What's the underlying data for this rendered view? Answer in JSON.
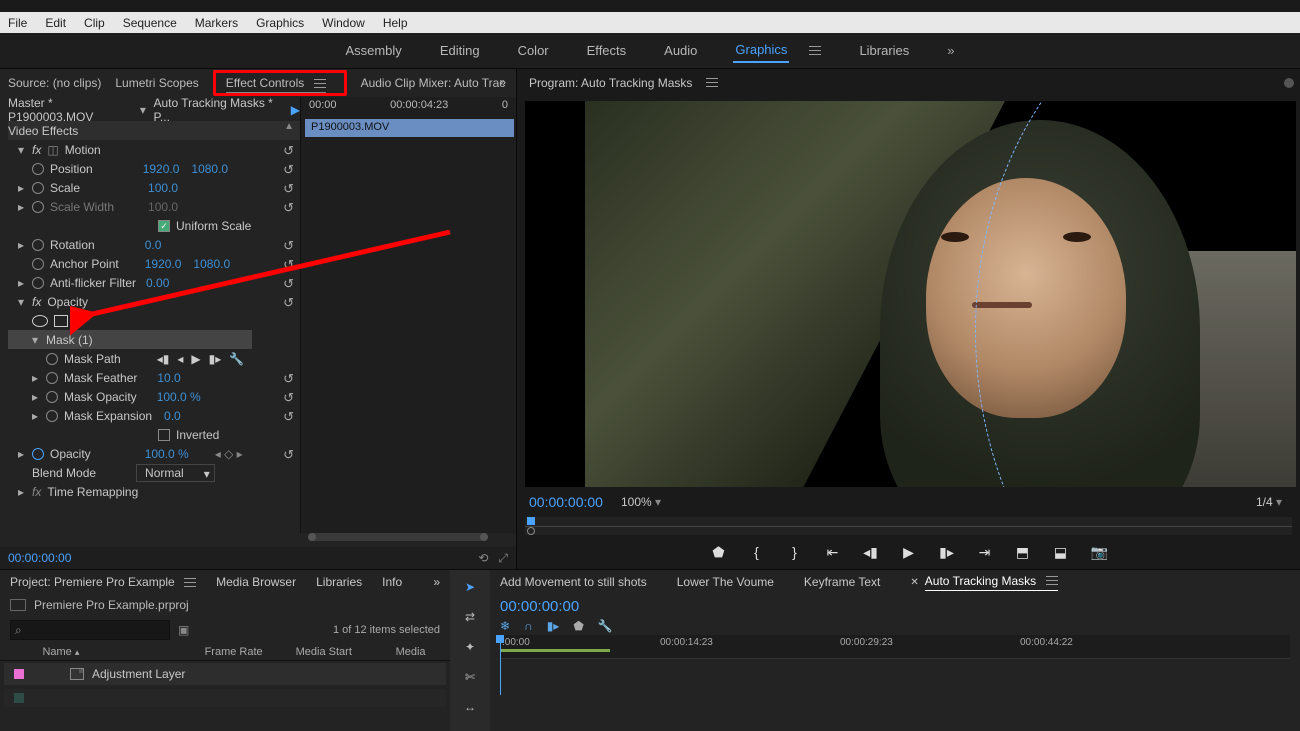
{
  "menu": {
    "file": "File",
    "edit": "Edit",
    "clip": "Clip",
    "sequence": "Sequence",
    "markers": "Markers",
    "graphics": "Graphics",
    "window": "Window",
    "help": "Help"
  },
  "workspaces": {
    "assembly": "Assembly",
    "editing": "Editing",
    "color": "Color",
    "effects": "Effects",
    "audio": "Audio",
    "graphics": "Graphics",
    "libraries": "Libraries",
    "overflow": "»"
  },
  "source_tabs": {
    "source": "Source: (no clips)",
    "lumetri": "Lumetri Scopes",
    "effect_controls": "Effect Controls",
    "audio_mixer": "Audio Clip Mixer: Auto Trac",
    "overflow": "»"
  },
  "ec": {
    "master": "Master * P1900003.MOV",
    "seq": "Auto Tracking Masks * P...",
    "tc_start": "00:00",
    "tc_mid": "00:00:04:23",
    "tc_end": "0",
    "clip": "P1900003.MOV",
    "video_effects": "Video Effects",
    "motion": "Motion",
    "position": "Position",
    "position_x": "1920.0",
    "position_y": "1080.0",
    "scale": "Scale",
    "scale_v": "100.0",
    "scale_width": "Scale Width",
    "scale_width_v": "100.0",
    "uniform": "Uniform Scale",
    "rotation": "Rotation",
    "rotation_v": "0.0",
    "anchor": "Anchor Point",
    "anchor_x": "1920.0",
    "anchor_y": "1080.0",
    "aff": "Anti-flicker Filter",
    "aff_v": "0.00",
    "opacity": "Opacity",
    "mask": "Mask (1)",
    "mask_path": "Mask Path",
    "mask_feather": "Mask Feather",
    "mask_feather_v": "10.0",
    "mask_opacity": "Mask Opacity",
    "mask_opacity_v": "100.0 %",
    "mask_expansion": "Mask Expansion",
    "mask_expansion_v": "0.0",
    "inverted": "Inverted",
    "opacity_prop": "Opacity",
    "opacity_v": "100.0 %",
    "blend": "Blend Mode",
    "blend_v": "Normal",
    "time_remap": "Time Remapping",
    "footer_tc": "00:00:00:00"
  },
  "program": {
    "label": "Program: Auto Tracking Masks",
    "tc": "00:00:00:00",
    "zoom": "100%",
    "res": "1/4"
  },
  "project": {
    "tab_project": "Project: Premiere Pro  Example",
    "tab_media": "Media Browser",
    "tab_libraries": "Libraries",
    "tab_info": "Info",
    "overflow": "»",
    "file": "Premiere Pro Example.prproj",
    "selected": "1 of 12 items selected",
    "col_name": "Name",
    "col_fr": "Frame Rate",
    "col_ms": "Media Start",
    "col_me": "Media",
    "row1": "Adjustment Layer"
  },
  "timeline": {
    "seq1": "Add Movement to still shots",
    "seq2": "Lower The Voume",
    "seq3": "Keyframe Text",
    "seq4": "Auto Tracking Masks",
    "tc": "00:00:00:00",
    "r0": ":00:00",
    "r1": "00:00:14:23",
    "r2": "00:00:29:23",
    "r3": "00:00:44:22"
  }
}
